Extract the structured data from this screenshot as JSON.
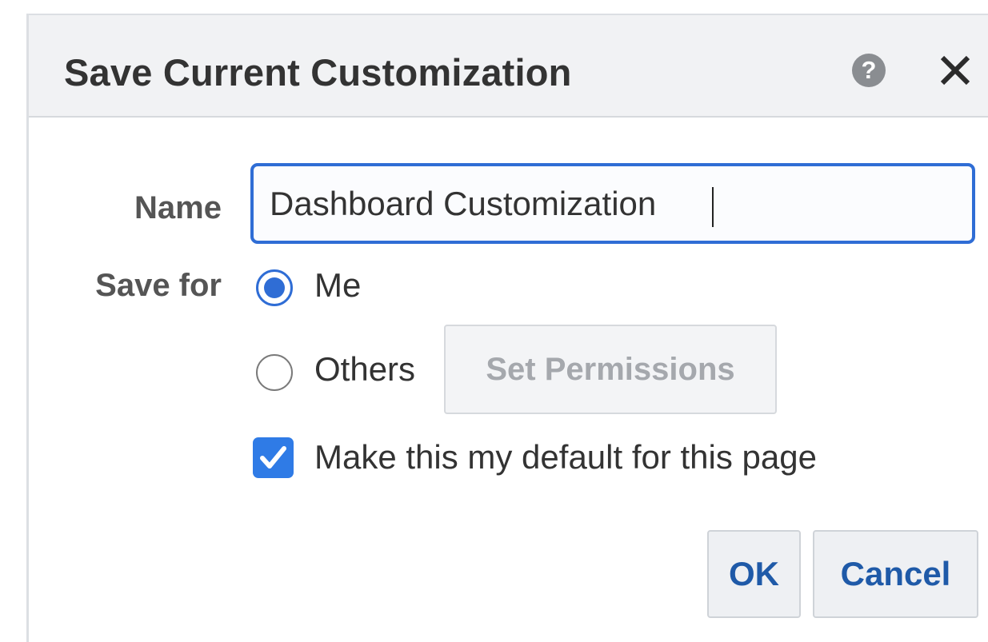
{
  "dialog": {
    "title": "Save Current Customization",
    "help_icon": "question-circle-icon",
    "close_icon": "close-x-icon"
  },
  "form": {
    "name_label": "Name",
    "name_value": "Dashboard Customization",
    "save_for_label": "Save for",
    "options": [
      {
        "label": "Me",
        "selected": true
      },
      {
        "label": "Others",
        "selected": false
      }
    ],
    "set_permissions_label": "Set Permissions",
    "default_checkbox_label": "Make this my default for this page",
    "default_checked": true
  },
  "buttons": {
    "ok_label": "OK",
    "cancel_label": "Cancel"
  },
  "colors": {
    "accent": "#2f6dd5",
    "checkbox": "#2f7be6",
    "button_text": "#1f5aa8",
    "title_bar": "#f1f2f4"
  }
}
